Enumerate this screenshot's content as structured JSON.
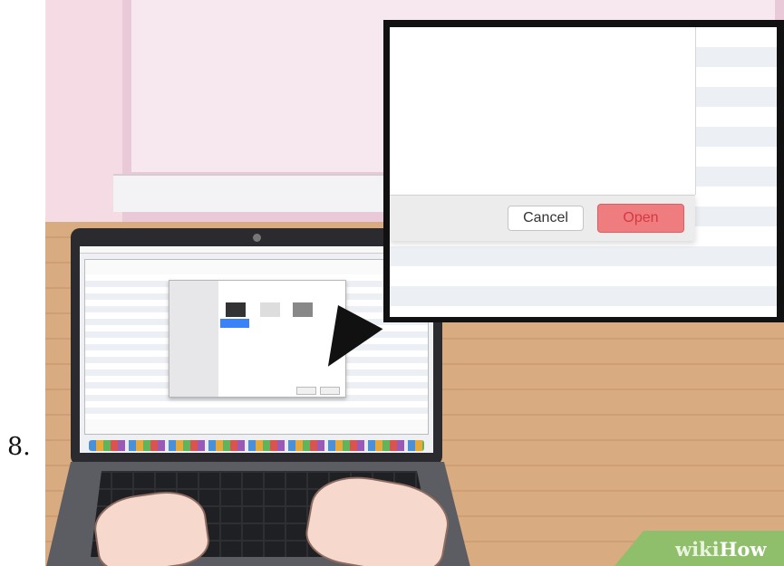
{
  "step": {
    "number": "8."
  },
  "dialog": {
    "cancel_label": "Cancel",
    "open_label": "Open",
    "open_color": "#ef7d80"
  },
  "watermark": {
    "part1": "wiki",
    "part2": "How"
  }
}
